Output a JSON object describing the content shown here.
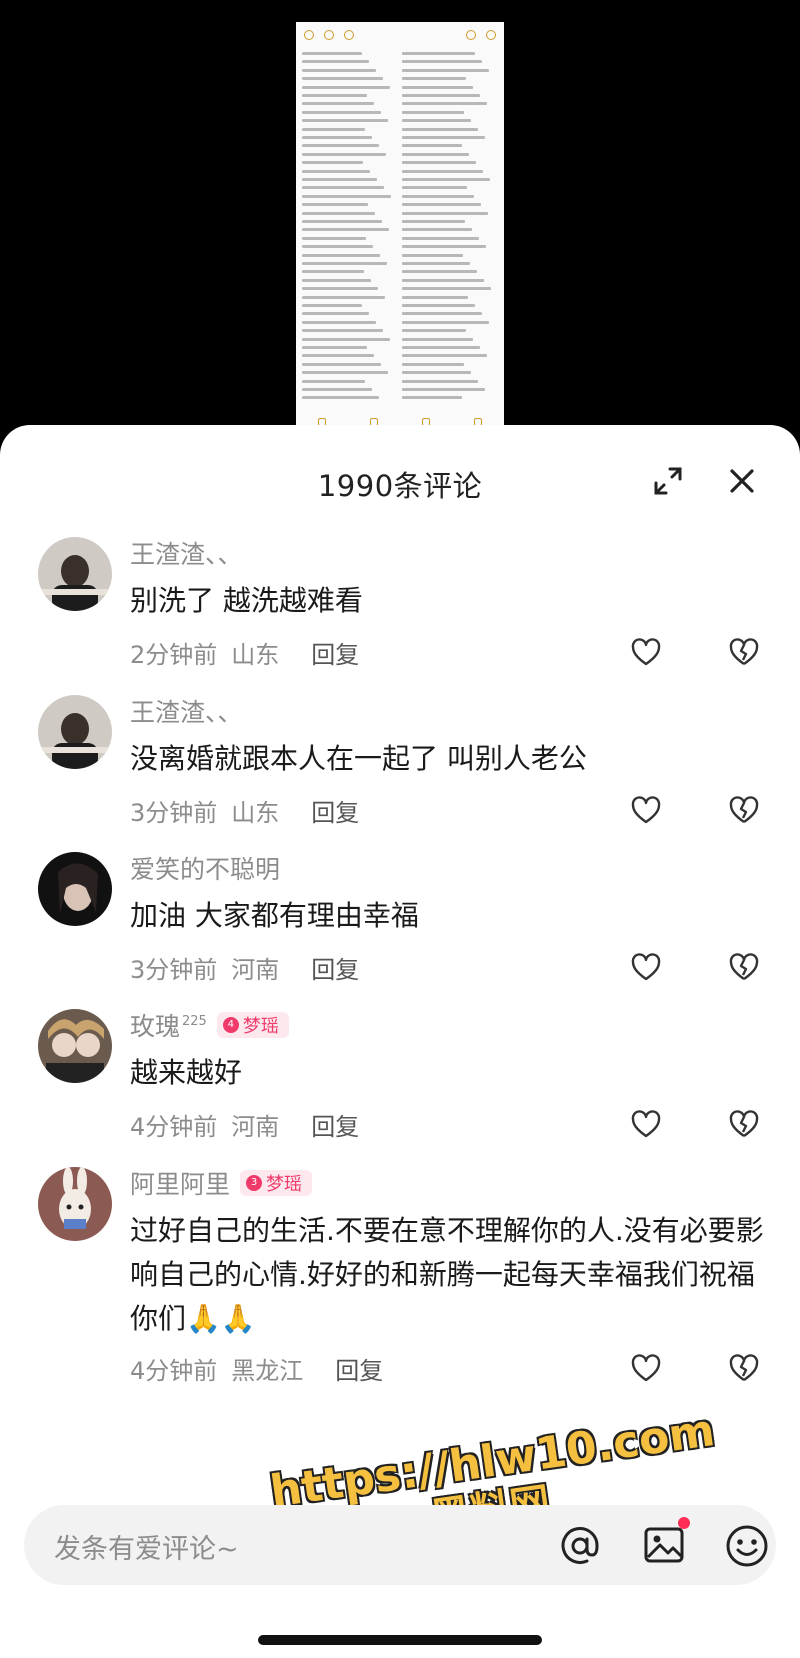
{
  "sheet": {
    "title": "1990条评论"
  },
  "comments": [
    {
      "name": "王渣渣、、",
      "text": "别洗了 越洗越难看",
      "time": "2分钟前",
      "location": "山东",
      "reply": "回复"
    },
    {
      "name": "王渣渣、、",
      "text": "没离婚就跟本人在一起了 叫别人老公",
      "time": "3分钟前",
      "location": "山东",
      "reply": "回复"
    },
    {
      "name": "爱笑的不聪明",
      "text": "加油 大家都有理由幸福",
      "time": "3分钟前",
      "location": "河南",
      "reply": "回复"
    },
    {
      "name": "玫瑰",
      "name_sup": "225",
      "badge": "梦瑶",
      "badge_level": "4",
      "text": "越来越好",
      "time": "4分钟前",
      "location": "河南",
      "reply": "回复"
    },
    {
      "name": "阿里阿里",
      "badge": "梦瑶",
      "badge_level": "3",
      "text": "过好自己的生活.不要在意不理解你的人.没有必要影响自己的心情.好好的和新腾一起每天幸福我们祝福你们🙏🙏",
      "time": "4分钟前",
      "location": "黑龙江",
      "reply": "回复"
    }
  ],
  "input": {
    "placeholder": "发条有爱评论~"
  },
  "watermark": {
    "url": "https://hlw10.com",
    "label": "黑料网"
  },
  "colors": {
    "accent_pink": "#f03a6a",
    "text_gray": "#8c8c8c",
    "watermark_yellow": "#f5c040"
  },
  "icons": [
    "expand-icon",
    "close-icon",
    "heart-like-icon",
    "broken-heart-dislike-icon",
    "at-icon",
    "image-icon",
    "emoji-icon"
  ]
}
